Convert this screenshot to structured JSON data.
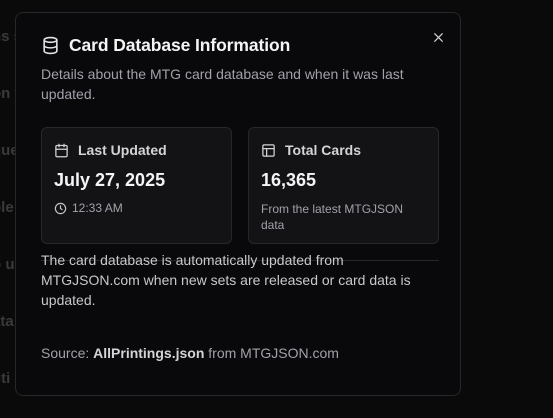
{
  "background": {
    "lines": [
      "ns s",
      "on f",
      "que",
      "ble",
      "o u",
      "ata",
      "titi"
    ]
  },
  "dialog": {
    "title": "Card Database Information",
    "description": "Details about the MTG card database and when it was last updated.",
    "close_icon": "close-icon",
    "title_icon": "database-icon",
    "cards": {
      "last_updated": {
        "icon": "calendar-icon",
        "label": "Last Updated",
        "value": "July 27, 2025",
        "time_icon": "clock-icon",
        "time": "12:33 AM"
      },
      "total_cards": {
        "icon": "table-icon",
        "label": "Total Cards",
        "value": "16,365",
        "note": "From the latest MTGJSON data"
      }
    },
    "info": "The card database is automatically updated from MTGJSON.com when new sets are released or card data is updated.",
    "source": {
      "prefix": "Source: ",
      "file": "AllPrintings.json",
      "suffix": " from MTGJSON.com"
    }
  },
  "colors": {
    "background": "#0a0a0b",
    "dialog_bg": "#09090b",
    "card_bg": "#131316",
    "border": "#27272a",
    "text_primary": "#f4f4f5",
    "text_muted": "#a1a1aa"
  }
}
